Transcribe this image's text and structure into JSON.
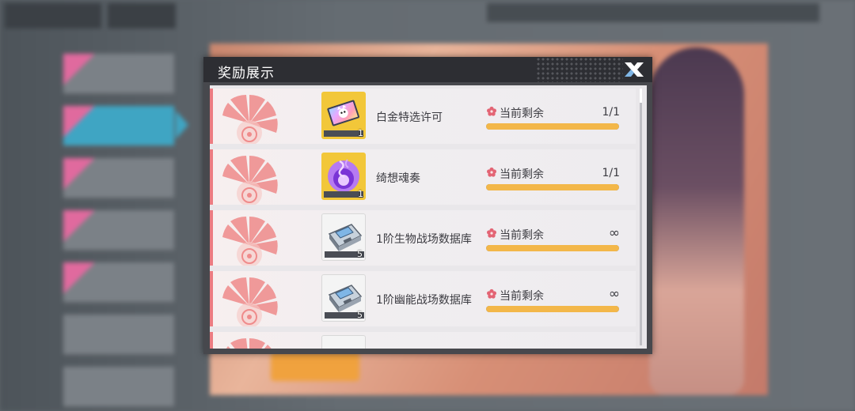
{
  "dialog": {
    "title": "奖励展示"
  },
  "rewards": [
    {
      "name": "白金特选许可",
      "quantity": "1",
      "remain_label": "当前剩余",
      "remain_value": "1/1",
      "remain_fraction": 1.0,
      "icon": "platinum-ticket-icon",
      "frame": "gold"
    },
    {
      "name": "绮想魂奏",
      "quantity": "1",
      "remain_label": "当前剩余",
      "remain_value": "1/1",
      "remain_fraction": 1.0,
      "icon": "purple-soul-orb-icon",
      "frame": "gold"
    },
    {
      "name": "1阶生物战场数据库",
      "quantity": "5",
      "remain_label": "当前剩余",
      "remain_value": "∞",
      "remain_fraction": 1.0,
      "icon": "data-device-icon",
      "frame": "white"
    },
    {
      "name": "1阶幽能战场数据库",
      "quantity": "5",
      "remain_label": "当前剩余",
      "remain_value": "∞",
      "remain_fraction": 1.0,
      "icon": "data-device-icon",
      "frame": "white"
    }
  ],
  "colors": {
    "progress_fill": "#f3b749",
    "accent_pink": "#ec7c82",
    "gold_frame": "#f2c739"
  }
}
